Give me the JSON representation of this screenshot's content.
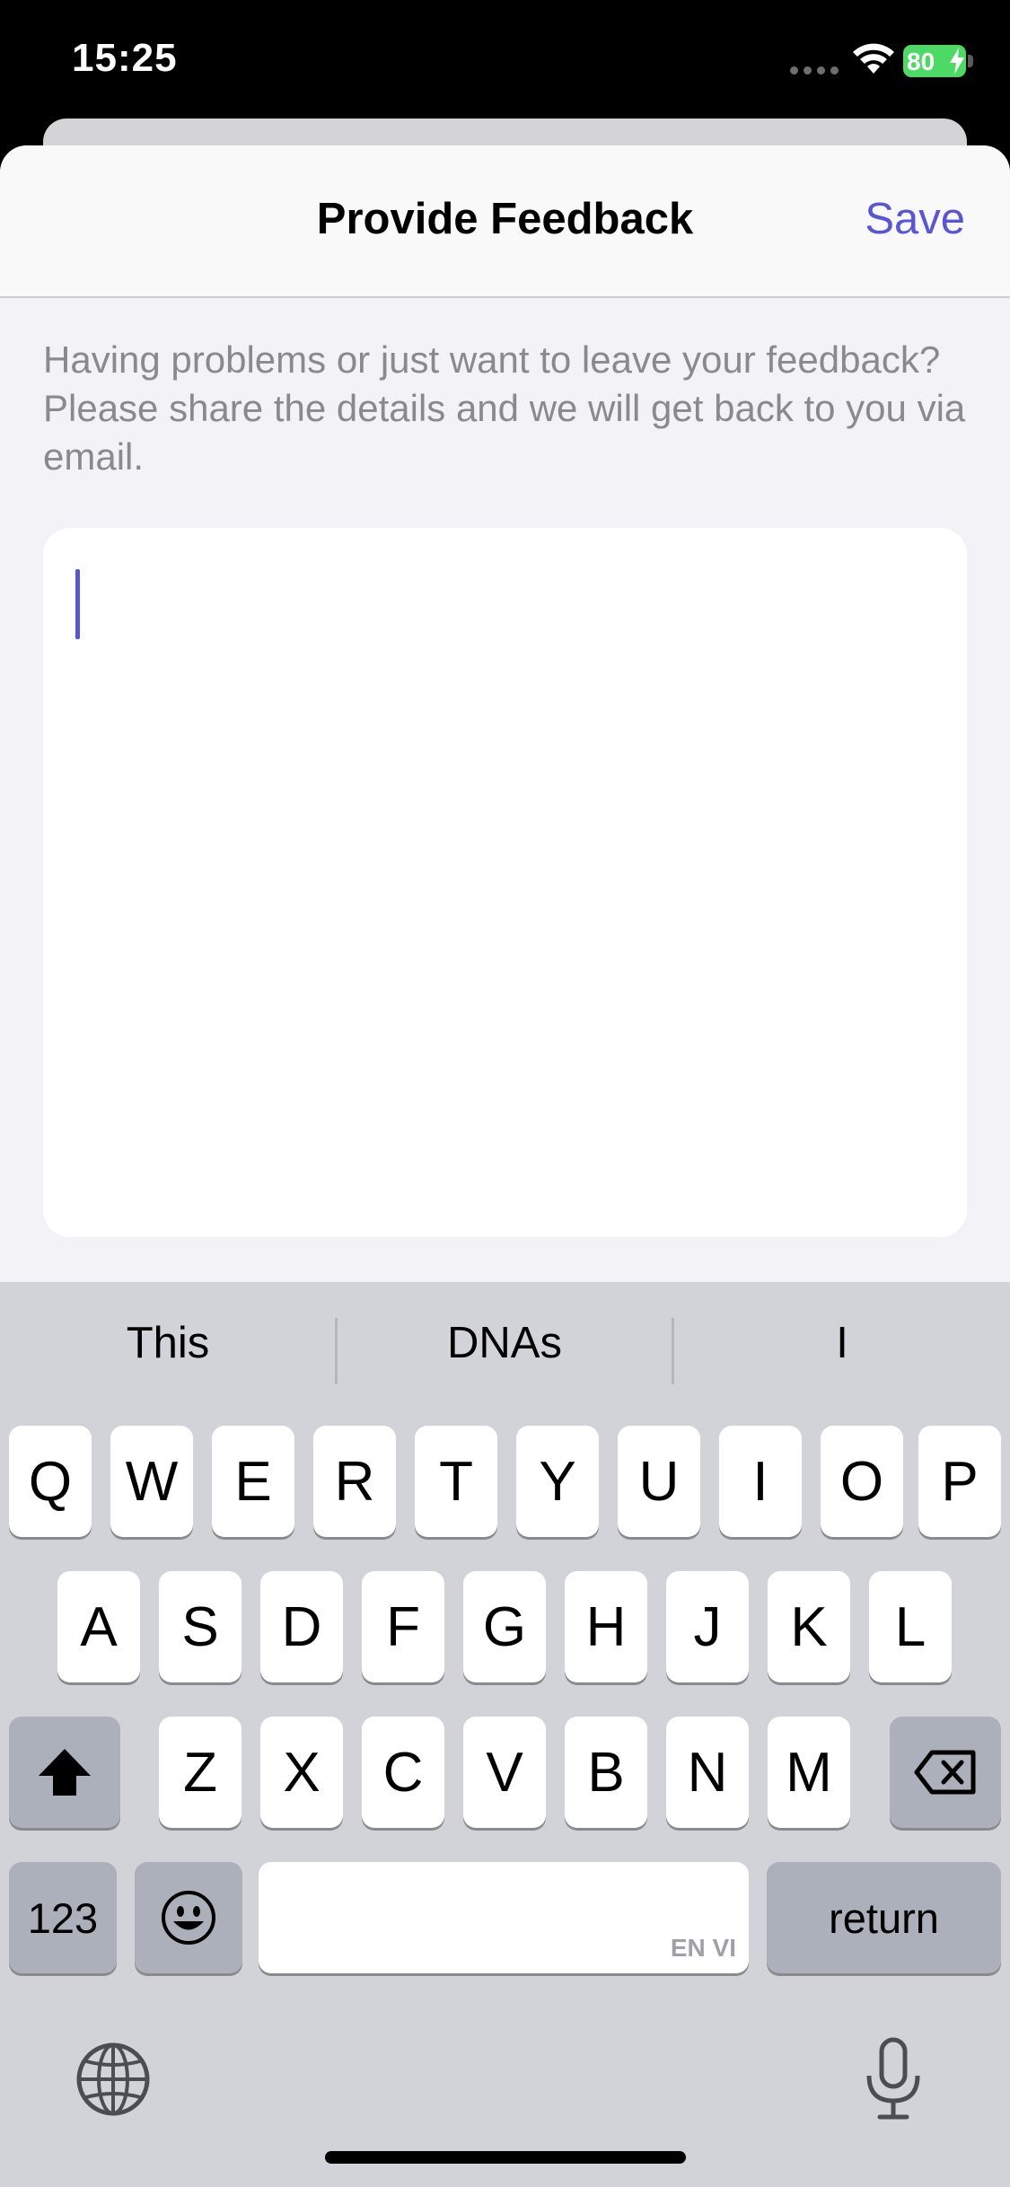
{
  "status": {
    "time": "15:25",
    "battery": "80"
  },
  "nav": {
    "title": "Provide Feedback",
    "save_label": "Save"
  },
  "description": "Having problems or just want to leave your feedback? Please share the details and we will get back to you via email.",
  "feedback_input": {
    "value": ""
  },
  "keyboard": {
    "suggestions": [
      "This",
      "DNAs",
      "I"
    ],
    "row1": [
      "Q",
      "W",
      "E",
      "R",
      "T",
      "Y",
      "U",
      "I",
      "O",
      "P"
    ],
    "row2": [
      "A",
      "S",
      "D",
      "F",
      "G",
      "H",
      "J",
      "K",
      "L"
    ],
    "row3": [
      "Z",
      "X",
      "C",
      "V",
      "B",
      "N",
      "M"
    ],
    "numbers_label": "123",
    "return_label": "return",
    "space_hint": "EN VI"
  },
  "colors": {
    "accent": "#5856d6",
    "battery": "#4cd964"
  }
}
